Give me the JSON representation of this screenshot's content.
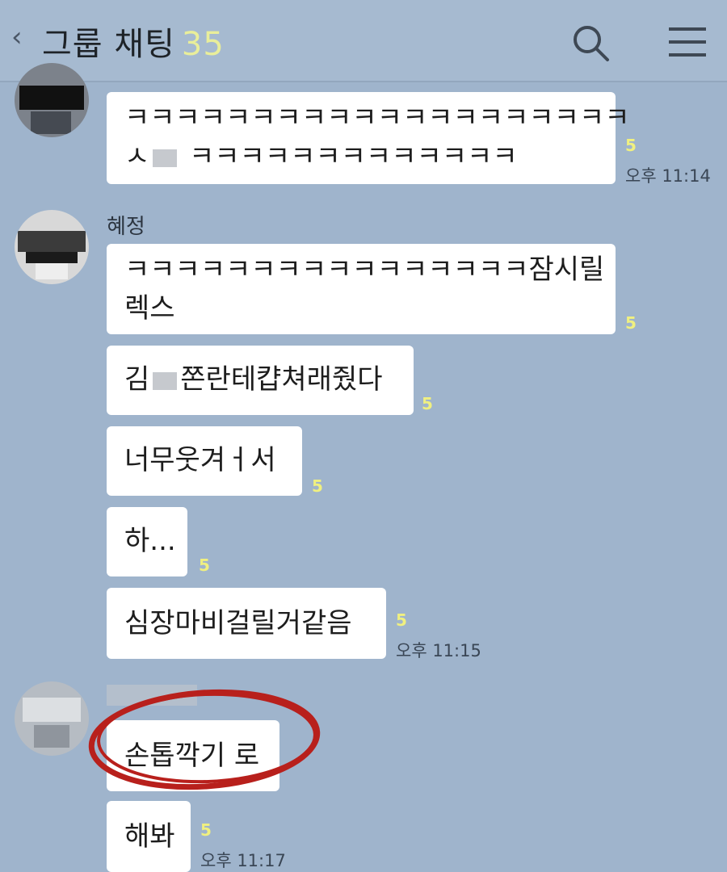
{
  "header": {
    "back_icon": "chevron-left-icon",
    "title": "그룹 채팅",
    "member_count": "35",
    "search_icon": "search-icon",
    "menu_icon": "menu-icon"
  },
  "groups": [
    {
      "sender": "",
      "messages": [
        {
          "lines": [
            "ㅋㅋㅋㅋㅋㅋㅋㅋㅋㅋㅋㅋㅋㅋㅋㅋㅋㅋㅋㅋ",
            "ㅅ",
            "ㅋㅋㅋㅋㅋㅋㅋㅋㅋㅋㅋㅋㅋ"
          ],
          "unread": "5",
          "time": "오후 11:14"
        }
      ]
    },
    {
      "sender": "혜정",
      "messages": [
        {
          "lines": [
            "ㅋㅋㅋㅋㅋㅋㅋㅋㅋㅋㅋㅋㅋㅋㅋㅋ잠시릴",
            "렉스"
          ],
          "unread": "5",
          "time": ""
        },
        {
          "lines": [
            "김",
            "쫀란테캽쳐래줬다"
          ],
          "unread": "5",
          "time": ""
        },
        {
          "lines": [
            "너무웃겨ㅓ서"
          ],
          "unread": "5",
          "time": ""
        },
        {
          "lines": [
            "하..."
          ],
          "unread": "5",
          "time": ""
        },
        {
          "lines": [
            "심장마비걸릴거같음"
          ],
          "unread": "5",
          "time": "오후 11:15"
        }
      ]
    },
    {
      "sender": "",
      "messages": [
        {
          "lines": [
            "손톱깍기 로"
          ],
          "unread": "",
          "time": ""
        },
        {
          "lines": [
            "해봐"
          ],
          "unread": "5",
          "time": "오후 11:17"
        }
      ]
    }
  ],
  "annotation": {
    "color": "#b8201c"
  }
}
